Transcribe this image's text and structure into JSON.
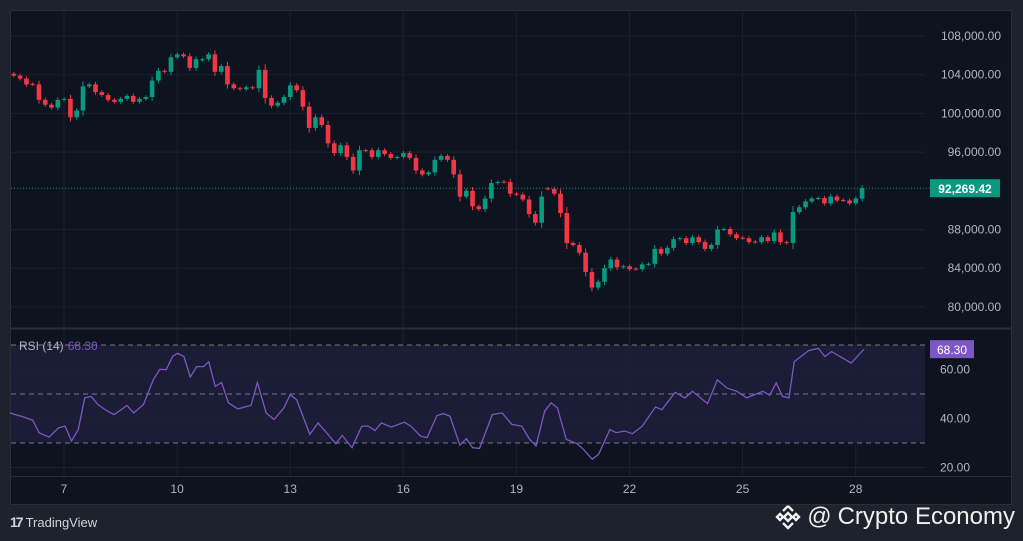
{
  "chart_data": [
    {
      "type": "candlestick",
      "title": "",
      "x_unit": "day of month",
      "first_candle_day": 5.67,
      "candles_per_day": 6,
      "x_ticks": [
        "7",
        "10",
        "13",
        "16",
        "19",
        "22",
        "25",
        "28"
      ],
      "x_tick_days": [
        7,
        10,
        13,
        16,
        19,
        22,
        25,
        28
      ],
      "y_ticks": [
        "108,000.00",
        "104,000.00",
        "100,000.00",
        "96,000.00",
        "88,000.00",
        "84,000.00",
        "80,000.00"
      ],
      "y_tick_values": [
        108000,
        104000,
        100000,
        96000,
        88000,
        84000,
        80000
      ],
      "ylim": [
        78000,
        110000
      ],
      "last_price": 92269.42,
      "last_price_label": "92,269.42",
      "up_color": "#089981",
      "down_color": "#f23645",
      "open": [
        104100,
        103900,
        103600,
        103050,
        103000,
        101400,
        100900,
        100600,
        101400,
        101500,
        99600,
        100300,
        102800,
        103000,
        102200,
        101900,
        101400,
        101200,
        101500,
        101800,
        101200,
        101500,
        101700,
        103400,
        104400,
        104300,
        105800,
        106100,
        105900,
        104700,
        105500,
        105600,
        106100,
        104300,
        104900,
        103000,
        102600,
        102500,
        102700,
        102600,
        104500,
        101600,
        100800,
        101100,
        101700,
        102900,
        102400,
        100700,
        98500,
        99600,
        98800,
        96900,
        95900,
        96700,
        95500,
        94100,
        96200,
        96200,
        95500,
        96200,
        95800,
        95400,
        95500,
        95900,
        95400,
        94100,
        93700,
        93900,
        95200,
        95600,
        95200,
        93700,
        91400,
        92000,
        90400,
        90100,
        91200,
        92800,
        92950,
        92900,
        91700,
        91600,
        91100,
        89600,
        88700,
        92250,
        92200,
        91700,
        89700,
        86600,
        86400,
        85600,
        83600,
        82000,
        82600,
        84000,
        84900,
        84100,
        84200,
        83950,
        83900,
        84400,
        84450,
        86000,
        85500,
        86100,
        87000,
        87100,
        86600,
        87200,
        86700,
        86000,
        86400,
        88000,
        88050,
        87500,
        87150,
        87100,
        86750,
        86700,
        87200,
        86800,
        87700,
        86700,
        86600,
        89800,
        90300,
        90900,
        91200,
        91250,
        90700,
        91400,
        91050,
        91000,
        90700,
        91200
      ],
      "close": [
        103900,
        103600,
        103000,
        103000,
        101400,
        100900,
        100600,
        101400,
        101500,
        99600,
        100300,
        102800,
        103000,
        102200,
        101900,
        101400,
        101200,
        101500,
        101800,
        101200,
        101500,
        101700,
        103400,
        104400,
        104300,
        105800,
        106100,
        105900,
        104700,
        105600,
        105600,
        106100,
        104300,
        104900,
        103000,
        102600,
        102500,
        102700,
        102600,
        104500,
        101600,
        100800,
        101100,
        101700,
        102900,
        102400,
        100700,
        98500,
        99600,
        98800,
        96900,
        95900,
        96700,
        95500,
        94100,
        96200,
        96150,
        95500,
        96200,
        95800,
        95400,
        95500,
        95900,
        95400,
        94100,
        93700,
        93900,
        95200,
        95600,
        95200,
        93700,
        91400,
        92000,
        90400,
        90100,
        91200,
        92800,
        92900,
        92900,
        91700,
        91600,
        91100,
        89600,
        88700,
        91400,
        92200,
        91700,
        89700,
        86600,
        86400,
        85600,
        83600,
        82000,
        82600,
        84000,
        84900,
        84100,
        84200,
        83900,
        83900,
        84400,
        84450,
        86000,
        85500,
        86100,
        87000,
        87100,
        86600,
        87200,
        86700,
        86000,
        86400,
        88000,
        88050,
        87500,
        87100,
        87100,
        86700,
        86700,
        87200,
        86800,
        87700,
        86700,
        86600,
        89800,
        90300,
        90900,
        91200,
        91250,
        90700,
        91400,
        91000,
        91000,
        90700,
        91200,
        92269.42
      ]
    },
    {
      "type": "line",
      "name": "RSI (14)",
      "legend_label": "RSI (14)",
      "current_value_label": "68.30",
      "color": "#7e57c2",
      "band_upper": 70,
      "band_middle": 50,
      "band_lower": 30,
      "y_ticks": [
        "60.00",
        "40.00",
        "20.00"
      ],
      "y_tick_values": [
        60,
        40,
        20
      ],
      "ylim": [
        10,
        80
      ],
      "x": [
        5.56,
        5.91,
        6.17,
        6.34,
        6.6,
        6.86,
        7.03,
        7.2,
        7.38,
        7.55,
        7.72,
        7.9,
        8.15,
        8.33,
        8.67,
        8.85,
        9.11,
        9.37,
        9.54,
        9.71,
        9.88,
        10.01,
        10.18,
        10.35,
        10.52,
        10.7,
        10.84,
        11.01,
        11.18,
        11.36,
        11.61,
        11.79,
        11.96,
        12.13,
        12.36,
        12.57,
        12.83,
        13.0,
        13.17,
        13.52,
        13.74,
        14.04,
        14.21,
        14.38,
        14.64,
        14.9,
        15.07,
        15.25,
        15.42,
        15.68,
        16.03,
        16.2,
        16.46,
        16.63,
        16.89,
        17.06,
        17.24,
        17.5,
        17.67,
        17.84,
        18.02,
        18.36,
        18.62,
        18.88,
        19.14,
        19.35,
        19.52,
        19.75,
        19.92,
        20.09,
        20.32,
        20.61,
        20.78,
        21.01,
        21.18,
        21.48,
        21.65,
        21.87,
        22.08,
        22.34,
        22.69,
        22.86,
        23.21,
        23.47,
        23.67,
        24.07,
        24.33,
        24.59,
        24.85,
        25.11,
        25.54,
        25.72,
        25.89,
        26.06,
        26.23,
        26.37,
        26.75,
        27.01,
        27.18,
        27.36,
        27.62,
        27.88,
        28.22
      ],
      "values": [
        42.3,
        40.7,
        39.3,
        34.2,
        32.4,
        36.2,
        36.9,
        30.8,
        35.5,
        48.4,
        49,
        45.7,
        43,
        41.6,
        45.3,
        42.3,
        45.7,
        55.8,
        60.1,
        59.9,
        65.3,
        66.6,
        65.3,
        56.9,
        61.2,
        61.2,
        63.2,
        53.1,
        54.7,
        46.4,
        43.9,
        44.7,
        45.3,
        54.7,
        42.3,
        39.6,
        44.3,
        49.7,
        47.7,
        33.5,
        38.2,
        32.8,
        29.7,
        33.1,
        28.1,
        36.9,
        36.9,
        35.1,
        38.2,
        36.5,
        38.5,
        36.9,
        32.8,
        32.2,
        41.2,
        42,
        40.9,
        29.1,
        31.8,
        28.1,
        27.8,
        41.6,
        42.3,
        37.6,
        36.9,
        31.5,
        28.8,
        43,
        46.4,
        44.3,
        31.5,
        29.7,
        27.4,
        23.4,
        25.4,
        35.5,
        34.2,
        34.9,
        33.8,
        36.9,
        44.7,
        43.6,
        50.7,
        48.4,
        51.1,
        46.1,
        55.8,
        52.4,
        51.1,
        48.4,
        51.1,
        49.5,
        54.5,
        49,
        48.4,
        63.2,
        67.7,
        68.6,
        65.3,
        67.3,
        65,
        62.6,
        68.3
      ]
    }
  ],
  "footer": {
    "tradingview_mark": "17",
    "tradingview_label": "TradingView",
    "watermark_at": "@",
    "watermark_label": "Crypto Economy"
  }
}
